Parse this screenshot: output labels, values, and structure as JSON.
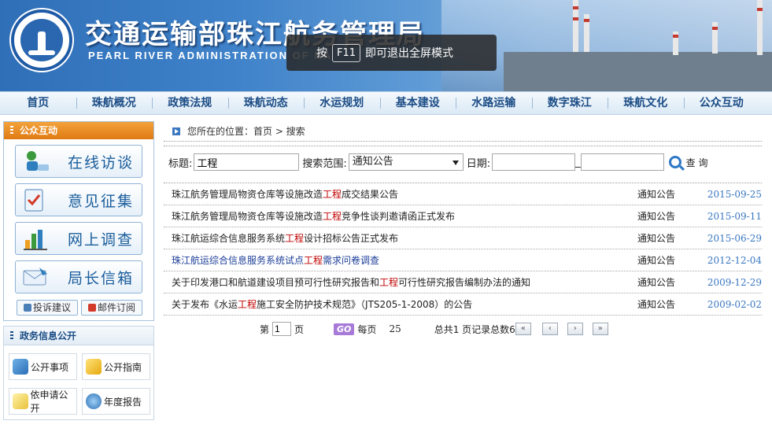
{
  "header": {
    "title_cn": "交通运输部珠江航务管理局",
    "title_en": "PEARL  RIVER  ADMINISTRATION  OF  NA"
  },
  "toast": {
    "prefix": "按",
    "key": "F11",
    "suffix": "即可退出全屏模式"
  },
  "nav": [
    "首页",
    "珠航概况",
    "政策法规",
    "珠航动态",
    "水运规划",
    "基本建设",
    "水路运输",
    "数字珠江",
    "珠航文化",
    "公众互动"
  ],
  "sidebar": {
    "box_title": "公众互动",
    "big_buttons": [
      "在线访谈",
      "意见征集",
      "网上调查",
      "局长信箱"
    ],
    "small_buttons": [
      "投诉建议",
      "邮件订阅"
    ],
    "gov_title": "政务信息公开",
    "gov_buttons": [
      "公开事项",
      "公开指南",
      "依申请公开",
      "年度报告"
    ]
  },
  "breadcrumb": {
    "text": "您所在的位置：首页 > 搜索"
  },
  "search": {
    "title_label": "标题:",
    "title_value": "工程",
    "scope_label": "搜索范围:",
    "scope_value": "通知公告",
    "date_label": "日期:",
    "date_from": "",
    "date_sep": "_",
    "date_to": "",
    "button": "查 询"
  },
  "results": [
    {
      "pre": "珠江航务管理局物资仓库等设施改造",
      "kw": "工程",
      "post": "成交结果公告",
      "category": "通知公告",
      "date": "2015-09-25",
      "visited": false
    },
    {
      "pre": "珠江航务管理局物资仓库等设施改造",
      "kw": "工程",
      "post": "竞争性谈判邀请函正式发布",
      "category": "通知公告",
      "date": "2015-09-11",
      "visited": false
    },
    {
      "pre": "珠江航运综合信息服务系统",
      "kw": "工程",
      "post": "设计招标公告正式发布",
      "category": "通知公告",
      "date": "2015-06-29",
      "visited": false
    },
    {
      "pre": "珠江航运综合信息服务系统试点",
      "kw": "工程",
      "post": "需求问卷调查",
      "category": "通知公告",
      "date": "2012-12-04",
      "visited": true
    },
    {
      "pre": "关于印发港口和航道建设项目预可行性研究报告和",
      "kw": "工程",
      "post": "可行性研究报告编制办法的通知",
      "category": "通知公告",
      "date": "2009-12-29",
      "visited": false
    },
    {
      "pre": "关于发布《水运",
      "kw": "工程",
      "post": "施工安全防护技术规范》（JTS205-1-2008）的公告",
      "category": "通知公告",
      "date": "2009-02-02",
      "visited": false
    }
  ],
  "pager": {
    "page_prefix": "第",
    "page_value": "1",
    "page_suffix": "页",
    "go": "GO",
    "per_page_label": "每页",
    "per_page": "25",
    "summary": "总共1 页记录总数6"
  },
  "colors": {
    "accent": "#1c4d86",
    "keyword": "#c00000",
    "date": "#3a77c0",
    "box_head": "#e98a22"
  }
}
